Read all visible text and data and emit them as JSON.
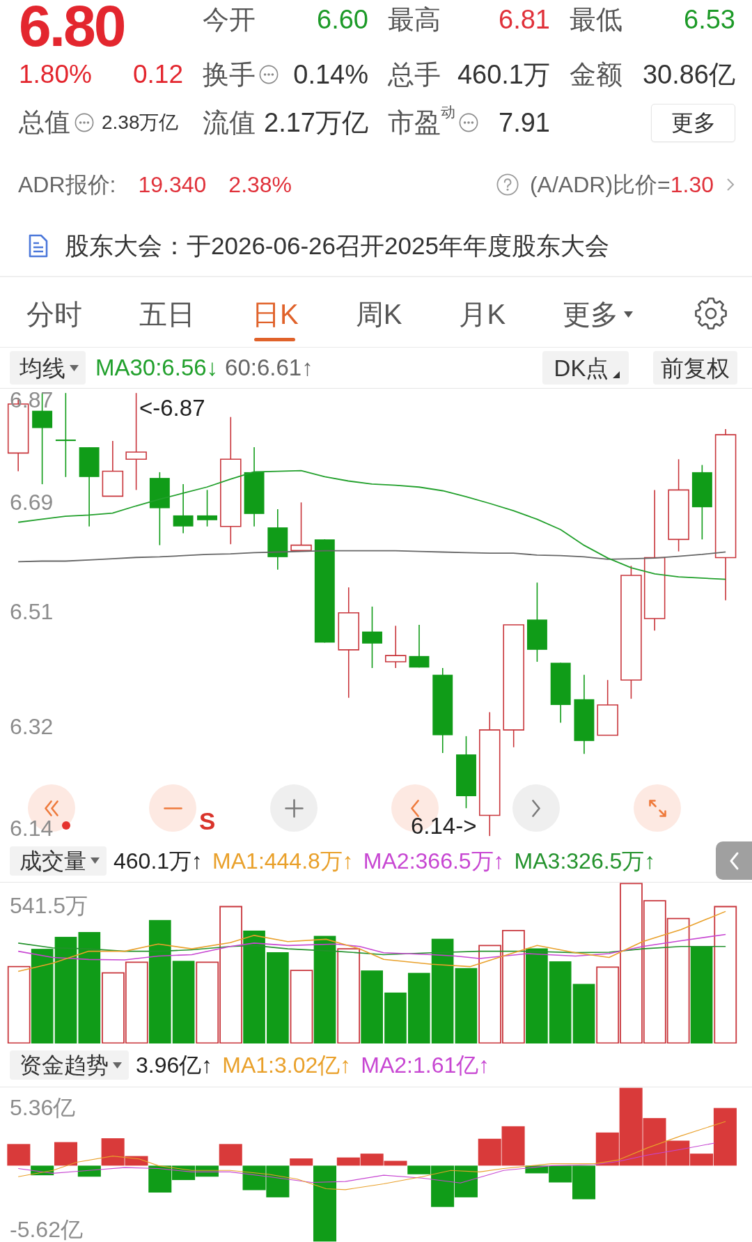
{
  "quote": {
    "price": "6.80",
    "change_percent": "1.80%",
    "change": "0.12"
  },
  "stats": [
    {
      "label": "今开",
      "value": "6.60",
      "color": "#1d9a28",
      "info": false
    },
    {
      "label": "最高",
      "value": "6.81",
      "color": "#e0313a",
      "info": false
    },
    {
      "label": "最低",
      "value": "6.53",
      "color": "#1d9a28",
      "info": false
    },
    {
      "label": "换手",
      "value": "0.14%",
      "color": "#333333",
      "info": true
    },
    {
      "label": "总手",
      "value": "460.1万",
      "color": "#333333",
      "info": false
    },
    {
      "label": "金额",
      "value": "30.86亿",
      "color": "#333333",
      "info": false
    },
    {
      "label": "流值",
      "value": "2.17万亿",
      "color": "#333333",
      "info": false
    },
    {
      "label": "市盈$^{动}$",
      "value": "7.91",
      "color": "#333333",
      "info": true
    }
  ],
  "market_value": {
    "label": "总值",
    "value": "2.38万亿",
    "info": true
  },
  "more_button": "更多",
  "adr": {
    "label": "ADR报价:",
    "price": "19.340",
    "change": "2.38%",
    "ratio_label": "(A/ADR)比价=",
    "ratio": "1.30"
  },
  "notice": "股东大会：于2026-06-26召开2025年年度股东大会",
  "tabs": [
    {
      "label": "分时",
      "kind": "tab",
      "selected": false
    },
    {
      "label": "五日",
      "kind": "tab",
      "selected": false
    },
    {
      "label": "日K",
      "kind": "tab",
      "selected": true
    },
    {
      "label": "周K",
      "kind": "tab",
      "selected": false
    },
    {
      "label": "月K",
      "kind": "tab",
      "selected": false
    },
    {
      "label": "更多",
      "kind": "dropdown",
      "selected": false
    }
  ],
  "indicator_bar": {
    "selector": "均线",
    "readings": [
      {
        "text": "MA30:6.56↓",
        "color": "#21a02c"
      },
      {
        "text": "60:6.61↑",
        "color": "#666666"
      }
    ],
    "dk_button": "DK点",
    "adjust_button": "前复权"
  },
  "price_chart": {
    "chart_data": {
      "type": "line",
      "ylim": [
        6.14,
        6.87
      ],
      "yticks": [
        6.87,
        6.69,
        6.51,
        6.32,
        6.14
      ],
      "series": [
        {
          "color": "#22a02c",
          "values": [
            6.657,
            6.662,
            6.667,
            6.669,
            6.672,
            6.684,
            6.695,
            6.705,
            6.715,
            6.728,
            6.74,
            6.741,
            6.742,
            6.732,
            6.725,
            6.72,
            6.718,
            6.715,
            6.709,
            6.699,
            6.688,
            6.676,
            6.662,
            6.645,
            6.619,
            6.598,
            6.582,
            6.572,
            6.567,
            6.565,
            6.563
          ]
        },
        {
          "color": "#666666",
          "values": [
            6.592,
            6.593,
            6.593,
            6.595,
            6.597,
            6.599,
            6.6,
            6.602,
            6.604,
            6.605,
            6.607,
            6.608,
            6.609,
            6.61,
            6.61,
            6.61,
            6.61,
            6.609,
            6.608,
            6.607,
            6.606,
            6.606,
            6.603,
            6.602,
            6.6,
            6.596,
            6.597,
            6.598,
            6.601,
            6.604,
            6.608
          ]
        }
      ]
    },
    "high_marker": "<-6.87",
    "low_marker": "6.14->",
    "trade_marker": "S",
    "controls": [
      {
        "kind": "rewind",
        "disabled": false
      },
      {
        "kind": "zoom_out",
        "disabled": false
      },
      {
        "kind": "zoom_in",
        "disabled": true
      },
      {
        "kind": "previous",
        "disabled": false
      },
      {
        "kind": "next",
        "disabled": true
      },
      {
        "kind": "fullscreen",
        "disabled": false
      }
    ]
  },
  "volume": {
    "selector": "成交量",
    "readings": [
      {
        "text": "460.1万↑",
        "color": "#222222"
      },
      {
        "text": "MA1:444.8万↑",
        "color": "#e9a02a"
      },
      {
        "text": "MA2:366.5万↑",
        "color": "#c746d2"
      },
      {
        "text": "MA3:326.5万↑",
        "color": "#23922c"
      }
    ],
    "y_label": "541.5万"
  },
  "fund_trend": {
    "selector": "资金趋势",
    "readings": [
      {
        "text": "3.96亿↑",
        "color": "#222222"
      },
      {
        "text": "MA1:3.02亿↑",
        "color": "#e9a02a"
      },
      {
        "text": "MA2:1.61亿↑",
        "color": "#c746d2"
      }
    ],
    "y_labels": [
      "5.36亿",
      "-5.62亿"
    ]
  }
}
